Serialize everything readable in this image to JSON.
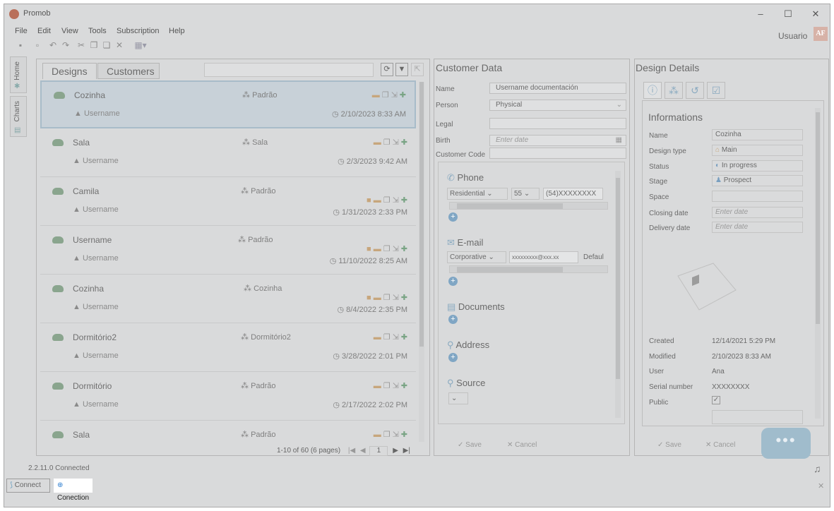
{
  "window": {
    "title": "Promob",
    "min": "–",
    "max": "☐",
    "close": "✕"
  },
  "menu": [
    "File",
    "Edit",
    "View",
    "Tools",
    "Subscription",
    "Help"
  ],
  "user": {
    "name": "Usuario",
    "initials": "AF"
  },
  "sidebar": {
    "home": "Home",
    "charts": "Charts"
  },
  "designs_panel": {
    "tabs": [
      "Designs",
      "Customers"
    ],
    "rows": [
      {
        "name": "Cozinha",
        "env": "Padrão",
        "user": "Username",
        "date": "2/10/2023 8:33 AM",
        "selected": true
      },
      {
        "name": "Sala",
        "env": "Sala",
        "user": "Username",
        "date": "2/3/2023 9:42 AM"
      },
      {
        "name": "Camila",
        "env": "Padrão",
        "user": "Username",
        "date": "1/31/2023 2:33 PM"
      },
      {
        "name": "Username",
        "env": "Padrão",
        "user": "Username",
        "date": "11/10/2022 8:25 AM"
      },
      {
        "name": "Cozinha",
        "env": "Cozinha",
        "user": "Username",
        "date": "8/4/2022 2:35 PM"
      },
      {
        "name": "Dormitório2",
        "env": "Dormitório2",
        "user": "Username",
        "date": "3/28/2022 2:01 PM"
      },
      {
        "name": "Dormitório",
        "env": "Padrão",
        "user": "Username",
        "date": "2/17/2022 2:02 PM"
      },
      {
        "name": "Sala",
        "env": "Padrão",
        "user": "",
        "date": ""
      }
    ],
    "pager": "1-10 of 60 (6 pages)",
    "page": "1"
  },
  "customer": {
    "title": "Customer Data",
    "name_label": "Name",
    "name_value": "Username documentación",
    "person_label": "Person",
    "person_value": "Physical",
    "legal_label": "Legal",
    "birth_label": "Birth",
    "birth_placeholder": "Enter date",
    "code_label": "Customer Code",
    "phone_title": "Phone",
    "phone_type": "Residential",
    "phone_code": "55",
    "phone_number": "(54)XXXXXXXX",
    "email_title": "E-mail",
    "email_type": "Corporative",
    "email_value": "xxxxxxxxx@xxx.xx",
    "email_default": "Defaul",
    "documents_title": "Documents",
    "address_title": "Address",
    "source_title": "Source",
    "save": "Save",
    "cancel": "Cancel"
  },
  "details": {
    "title": "Design Details",
    "section": "Informations",
    "name_label": "Name",
    "name_value": "Cozinha",
    "type_label": "Design type",
    "type_value": "Main",
    "status_label": "Status",
    "status_value": "In progress",
    "stage_label": "Stage",
    "stage_value": "Prospect",
    "space_label": "Space",
    "closing_label": "Closing date",
    "closing_placeholder": "Enter date",
    "delivery_label": "Delivery date",
    "delivery_placeholder": "Enter date",
    "created_label": "Created",
    "created_value": "12/14/2021 5:29 PM",
    "modified_label": "Modified",
    "modified_value": "2/10/2023 8:33 AM",
    "user_label": "User",
    "user_value": "Ana",
    "serial_label": "Serial number",
    "serial_value": "XXXXXXXX",
    "public_label": "Public",
    "save": "Save",
    "cancel": "Cancel"
  },
  "status": {
    "version": "2.2.11.0 Connected",
    "connect": "Connect",
    "conection": "Conection P"
  }
}
